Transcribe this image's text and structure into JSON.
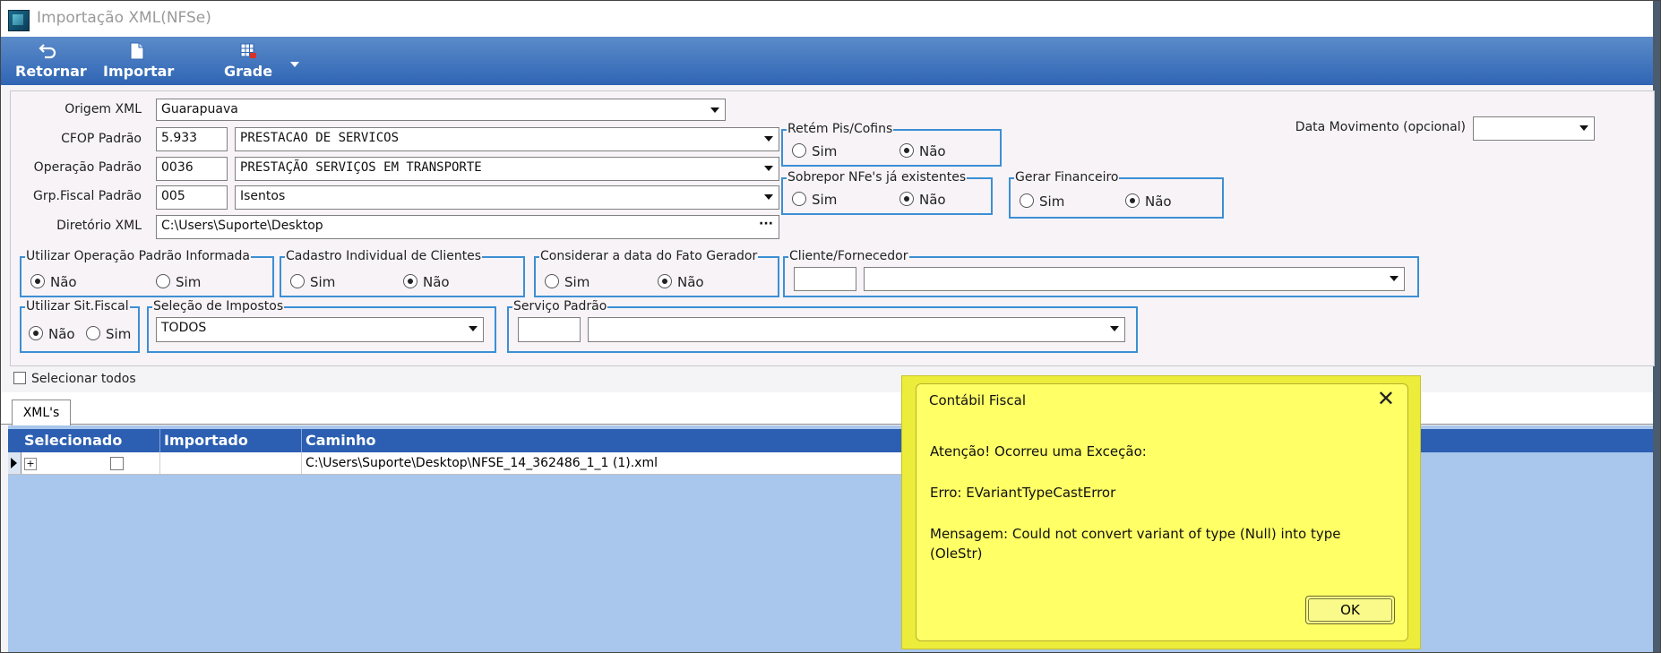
{
  "window": {
    "title": "Importação XML(NFSe)"
  },
  "toolbar": {
    "return_label": "Retornar",
    "import_label": "Importar",
    "grid_label": "Grade"
  },
  "form": {
    "origem_label": "Origem XML",
    "origem_value": "Guarapuava",
    "cfop_label": "CFOP Padrão",
    "cfop_code": "5.933",
    "cfop_desc": "PRESTACAO DE SERVICOS",
    "operacao_label": "Operação Padrão",
    "operacao_code": "0036",
    "operacao_desc": "PRESTAÇÃO SERVIÇOS EM TRANSPORTE",
    "grpfiscal_label": "Grp.Fiscal Padrão",
    "grpfiscal_code": "005",
    "grpfiscal_desc": "Isentos",
    "diretorio_label": "Diretório XML",
    "diretorio_value": "C:\\Users\\Suporte\\Desktop",
    "data_mov_label": "Data Movimento (opcional)",
    "data_mov_value": ""
  },
  "groups": {
    "retem": {
      "title": "Retém Pis/Cofins",
      "sim": "Sim",
      "nao": "Não"
    },
    "sobrepor": {
      "title": "Sobrepor NFe's já existentes",
      "sim": "Sim",
      "nao": "Não"
    },
    "gerar": {
      "title": "Gerar Financeiro",
      "sim": "Sim",
      "nao": "Não"
    },
    "utilizar_op": {
      "title": "Utilizar Operação Padrão Informada",
      "nao": "Não",
      "sim": "Sim"
    },
    "cadastro": {
      "title": "Cadastro Individual de Clientes",
      "sim": "Sim",
      "nao": "Não"
    },
    "considerar": {
      "title": "Considerar a data do Fato Gerador",
      "sim": "Sim",
      "nao": "Não"
    },
    "cliente": {
      "title": "Cliente/Fornecedor",
      "code": "",
      "value": ""
    },
    "sitfiscal": {
      "title": "Utilizar Sit.Fiscal",
      "nao": "Não",
      "sim": "Sim"
    },
    "impostos": {
      "title": "Seleção de Impostos",
      "value": "TODOS"
    },
    "servico": {
      "title": "Serviço Padrão",
      "code": "",
      "value": ""
    }
  },
  "selecionar_todos": "Selecionar todos",
  "tab_label": "XML's",
  "grid": {
    "headers": [
      "Selecionado",
      "Importado",
      "Caminho"
    ],
    "rows": [
      {
        "caminho": "C:\\Users\\Suporte\\Desktop\\NFSE_14_362486_1_1 (1).xml",
        "expander": "+"
      }
    ]
  },
  "dialog": {
    "title": "Contábil Fiscal",
    "close": "✕",
    "line1": "Atenção! Ocorreu uma Exceção:",
    "line2": "Erro: EVariantTypeCastError",
    "line3": " Mensagem: Could not convert variant of type (Null) into type",
    "line4": "(OleStr)",
    "ok_label": "OK"
  },
  "icons": {
    "return": "undo-arrow-icon",
    "import": "document-icon",
    "grid": "grid-icon"
  }
}
